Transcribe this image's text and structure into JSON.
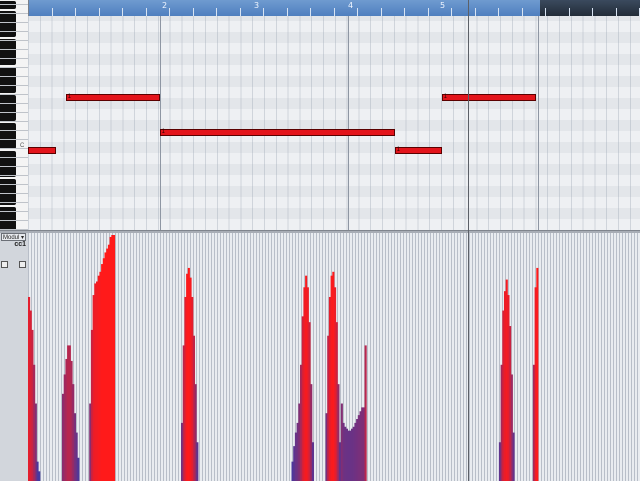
{
  "ruler": {
    "bars": [
      {
        "label": "2"
      },
      {
        "label": "3"
      },
      {
        "label": "4"
      },
      {
        "label": "5"
      }
    ]
  },
  "keyboard": {
    "octave_label": "C"
  },
  "notes": [
    {
      "pitch_row": 15,
      "start_beat": 0.0,
      "length_beats": 1.2,
      "velocity": ""
    },
    {
      "pitch_row": 9,
      "start_beat": 1.6,
      "length_beats": 4.0,
      "velocity": "1"
    },
    {
      "pitch_row": 13,
      "start_beat": 5.6,
      "length_beats": 10.0,
      "velocity": "1"
    },
    {
      "pitch_row": 15,
      "start_beat": 15.6,
      "length_beats": 2.0,
      "velocity": "1"
    },
    {
      "pitch_row": 9,
      "start_beat": 17.6,
      "length_beats": 4.0,
      "velocity": "1"
    }
  ],
  "controller": {
    "select_label": "Modul",
    "lane_label": "cc1",
    "colors": {
      "high": "#ff1a1a",
      "low": "#3a3aa8"
    },
    "values": [
      95,
      88,
      78,
      60,
      40,
      10,
      5,
      0,
      0,
      0,
      0,
      0,
      0,
      0,
      0,
      0,
      0,
      0,
      0,
      0,
      45,
      55,
      63,
      70,
      70,
      62,
      50,
      35,
      25,
      12,
      0,
      0,
      0,
      0,
      0,
      0,
      40,
      78,
      96,
      102,
      103,
      106,
      108,
      112,
      115,
      118,
      120,
      122,
      126,
      127,
      127,
      0,
      0,
      0,
      0,
      0,
      0,
      0,
      0,
      0,
      0,
      0,
      0,
      0,
      0,
      0,
      0,
      0,
      0,
      0,
      0,
      0,
      0,
      0,
      0,
      0,
      0,
      0,
      0,
      0,
      0,
      0,
      0,
      0,
      0,
      0,
      0,
      0,
      0,
      0,
      30,
      70,
      95,
      107,
      110,
      105,
      95,
      75,
      50,
      20,
      0,
      0,
      0,
      0,
      0,
      0,
      0,
      0,
      0,
      0,
      0,
      0,
      0,
      0,
      0,
      0,
      0,
      0,
      0,
      0,
      0,
      0,
      0,
      0,
      0,
      0,
      0,
      0,
      0,
      0,
      0,
      0,
      0,
      0,
      0,
      0,
      0,
      0,
      0,
      0,
      0,
      0,
      0,
      0,
      0,
      0,
      0,
      0,
      0,
      0,
      0,
      0,
      0,
      0,
      0,
      10,
      18,
      25,
      30,
      40,
      60,
      85,
      100,
      106,
      100,
      82,
      50,
      20,
      0,
      0,
      0,
      0,
      0,
      0,
      0,
      35,
      75,
      95,
      106,
      108,
      100,
      82,
      50,
      20,
      40,
      30,
      28,
      27,
      26,
      26,
      27,
      28,
      30,
      32,
      34,
      36,
      38,
      38,
      70,
      0,
      0,
      0,
      0,
      0,
      0,
      0,
      0,
      0,
      0,
      0,
      0,
      0,
      0,
      0,
      0,
      0,
      0,
      0,
      0,
      0,
      0,
      0,
      0,
      0,
      0,
      0,
      0,
      0,
      0,
      0,
      0,
      0,
      0,
      0,
      0,
      0,
      0,
      0,
      0,
      0,
      0,
      0,
      0,
      0,
      0,
      0,
      0,
      0,
      0,
      0,
      0,
      0,
      0,
      0,
      0,
      0,
      0,
      0,
      0,
      0,
      0,
      0,
      0,
      0,
      0,
      0,
      0,
      0,
      0,
      0,
      0,
      0,
      0,
      0,
      0,
      0,
      0,
      20,
      60,
      88,
      98,
      104,
      96,
      80,
      55,
      25,
      0,
      0,
      0,
      0,
      0,
      0,
      0,
      0,
      0,
      0,
      0,
      60,
      100,
      110
    ]
  }
}
